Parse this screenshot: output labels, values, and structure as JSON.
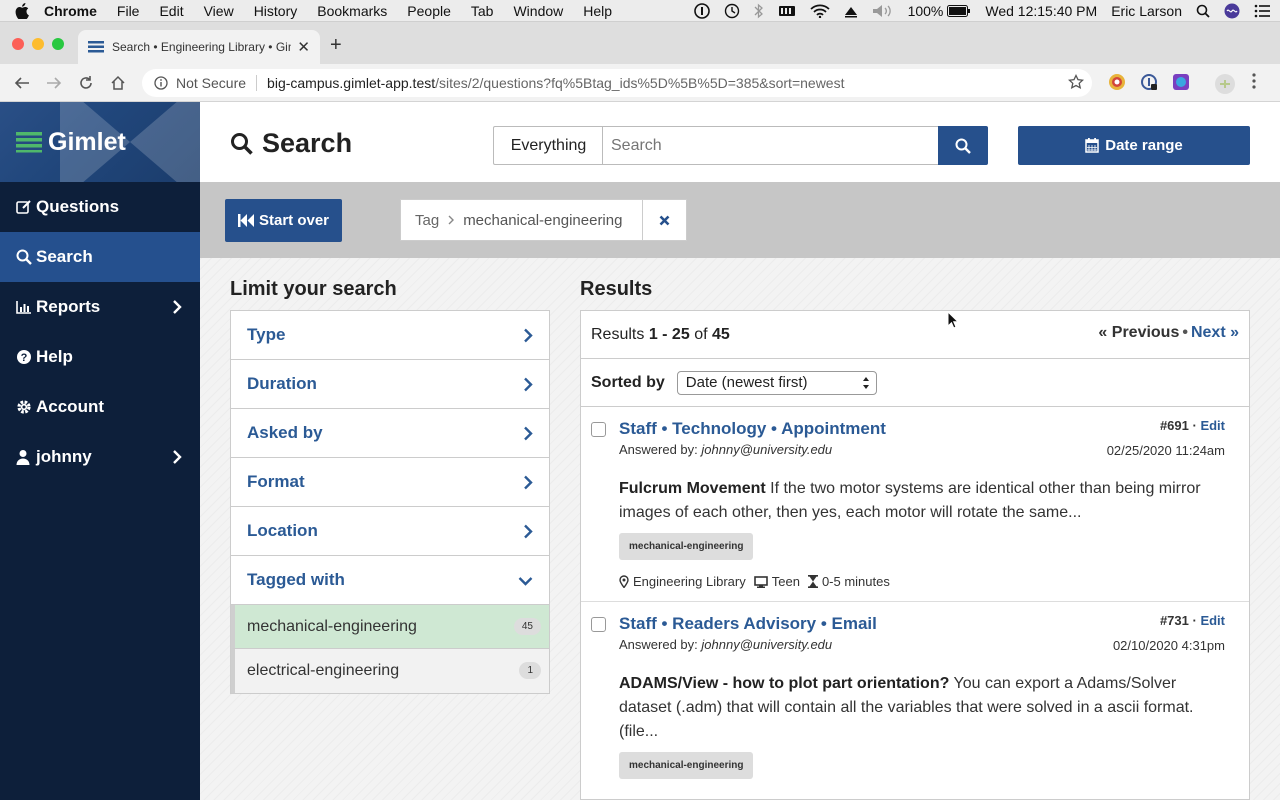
{
  "menubar": {
    "app": "Chrome",
    "items": [
      "File",
      "Edit",
      "View",
      "History",
      "Bookmarks",
      "People",
      "Tab",
      "Window",
      "Help"
    ],
    "battery": "100%",
    "clock": "Wed 12:15:40 PM",
    "user": "Eric Larson"
  },
  "browser": {
    "tab_title": "Search • Engineering Library • Gimlet",
    "not_secure": "Not Secure",
    "url_host": "big-campus.gimlet-app.test",
    "url_path": "/sites/2/questions?fq%5Btag_ids%5D%5B%5D=385&sort=newest"
  },
  "sidebar": {
    "brand": "Gimlet",
    "items": [
      {
        "label": "Questions",
        "icon": "edit-icon"
      },
      {
        "label": "Search",
        "icon": "search-icon"
      },
      {
        "label": "Reports",
        "icon": "bar-chart-icon"
      },
      {
        "label": "Help",
        "icon": "question-circle-icon"
      },
      {
        "label": "Account",
        "icon": "gear-icon"
      },
      {
        "label": "johnny",
        "icon": "user-icon"
      }
    ]
  },
  "header": {
    "title": "Search",
    "scope": "Everything",
    "search_placeholder": "Search",
    "date_range": "Date range"
  },
  "filterbar": {
    "start_over": "Start over",
    "chip_label": "Tag",
    "chip_value": "mechanical-engineering"
  },
  "facets": {
    "heading": "Limit your search",
    "items": [
      "Type",
      "Duration",
      "Asked by",
      "Format",
      "Location",
      "Tagged with"
    ],
    "options": [
      {
        "label": "mechanical-engineering",
        "count": "45"
      },
      {
        "label": "electrical-engineering",
        "count": "1"
      }
    ]
  },
  "results": {
    "heading": "Results",
    "summary_prefix": "Results",
    "range": "1 - 25",
    "of": "of",
    "total": "45",
    "prev": "« Previous",
    "dot": "•",
    "next": "Next »",
    "sorted_by": "Sorted by",
    "sort_value": "Date (newest first)",
    "items": [
      {
        "title": "Staff • Technology • Appointment",
        "id": "#691",
        "edit": "Edit",
        "answered_label": "Answered by:",
        "answered_by": "johnny@university.edu",
        "date": "02/25/2020 11:24am",
        "q_title": "Fulcrum Movement",
        "q_text": "If the two motor systems are identical other than being mirror images of each other, then yes, each motor will rotate the same...",
        "tag": "mechanical-engineering",
        "location": "Engineering Library",
        "format": "Teen",
        "duration": "0-5 minutes"
      },
      {
        "title": "Staff • Readers Advisory • Email",
        "id": "#731",
        "edit": "Edit",
        "answered_label": "Answered by:",
        "answered_by": "johnny@university.edu",
        "date": "02/10/2020 4:31pm",
        "q_title": "ADAMS/View - how to plot part orientation?",
        "q_text": "You can export a Adams/Solver dataset (.adm) that will contain all the variables that were solved in a ascii format. (file...",
        "tag": "mechanical-engineering"
      }
    ]
  },
  "colors": {
    "sidebar": "#0d1f3a",
    "active": "#25508e",
    "primary": "#26508c",
    "link": "#2b5a95",
    "selected_facet": "#cfe8d3"
  }
}
